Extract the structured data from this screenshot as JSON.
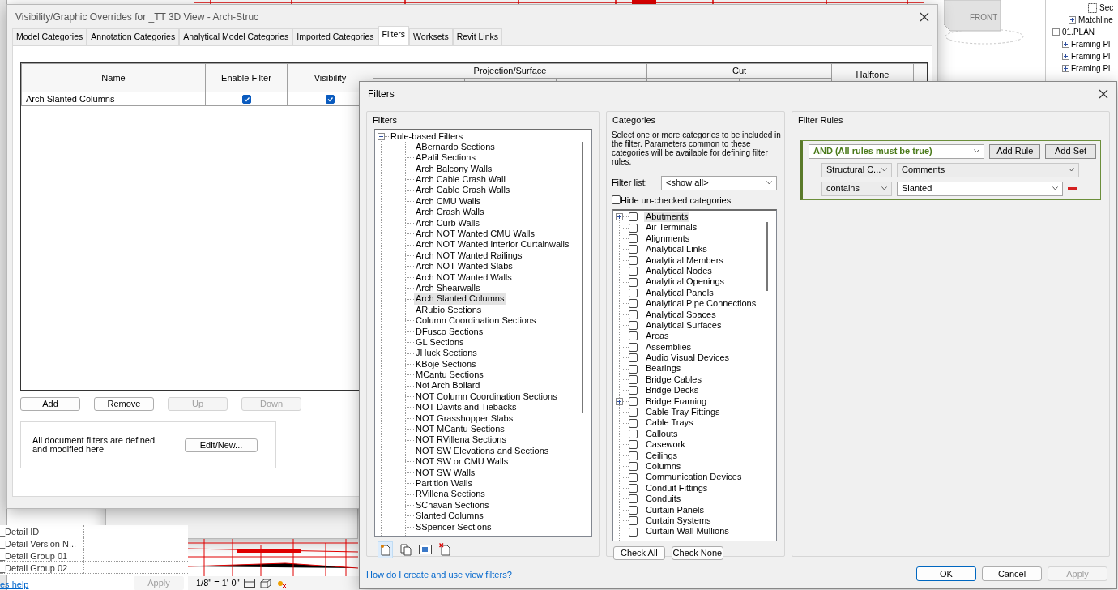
{
  "background": {
    "view_cube": "FRONT",
    "project_browser": [
      {
        "label": "Sec",
        "kind": "view"
      },
      {
        "label": "Matchline",
        "kind": "folder",
        "expanded": false
      },
      {
        "label": "01.PLAN",
        "kind": "folder",
        "expanded": true,
        "children": [
          {
            "label": "Framing Pl",
            "kind": "folder",
            "expanded": false
          },
          {
            "label": "Framing Pl",
            "kind": "folder",
            "expanded": false
          },
          {
            "label": "Framing Pl",
            "kind": "folder",
            "expanded": false
          }
        ]
      }
    ],
    "parameters": [
      "_Detail ID",
      "_Detail Version N...",
      "_Detail Group 01",
      "_Detail Group 02"
    ],
    "help_link": "es help",
    "apply_button": "Apply",
    "scale": "1/8\" = 1'-0\""
  },
  "vg_dialog": {
    "title": "Visibility/Graphic Overrides for _TT 3D View - Arch-Struc",
    "tabs": [
      {
        "label": "Model Categories",
        "selected": false
      },
      {
        "label": "Annotation Categories",
        "selected": false
      },
      {
        "label": "Analytical Model Categories",
        "selected": false
      },
      {
        "label": "Imported Categories",
        "selected": false
      },
      {
        "label": "Filters",
        "selected": true
      },
      {
        "label": "Worksets",
        "selected": false
      },
      {
        "label": "Revit Links",
        "selected": false
      }
    ],
    "table": {
      "columns": [
        "Name",
        "Enable Filter",
        "Visibility"
      ],
      "column_groups": [
        "Projection/Surface",
        "Cut"
      ],
      "last_column": "Halftone",
      "rows": [
        {
          "name": "Arch Slanted Columns",
          "enable_filter": true,
          "visibility": true
        }
      ]
    },
    "buttons": [
      {
        "label": "Add",
        "disabled": false
      },
      {
        "label": "Remove",
        "disabled": false
      },
      {
        "label": "Up",
        "disabled": true
      },
      {
        "label": "Down",
        "disabled": true
      }
    ],
    "note": "All document filters are defined and modified here",
    "edit_button": "Edit/New..."
  },
  "filters_dialog": {
    "title": "Filters",
    "filters": {
      "title": "Filters",
      "tree": {
        "label": "Rule-based Filters",
        "expanded": true,
        "children": [
          {
            "label": "ABernardo Sections",
            "selected": false
          },
          {
            "label": "APatil Sections",
            "selected": false
          },
          {
            "label": "Arch Balcony Walls",
            "selected": false
          },
          {
            "label": "Arch Cable Crash Wall",
            "selected": false
          },
          {
            "label": "Arch Cable Crash Walls",
            "selected": false
          },
          {
            "label": "Arch CMU Walls",
            "selected": false
          },
          {
            "label": "Arch Crash Walls",
            "selected": false
          },
          {
            "label": "Arch Curb Walls",
            "selected": false
          },
          {
            "label": "Arch NOT Wanted CMU Walls",
            "selected": false
          },
          {
            "label": "Arch NOT Wanted Interior Curtainwalls",
            "selected": false
          },
          {
            "label": "Arch NOT Wanted Railings",
            "selected": false
          },
          {
            "label": "Arch NOT Wanted Slabs",
            "selected": false
          },
          {
            "label": "Arch NOT Wanted Walls",
            "selected": false
          },
          {
            "label": "Arch Shearwalls",
            "selected": false
          },
          {
            "label": "Arch Slanted Columns",
            "selected": true
          },
          {
            "label": "ARubio Sections",
            "selected": false
          },
          {
            "label": "Column Coordination Sections",
            "selected": false
          },
          {
            "label": "DFusco Sections",
            "selected": false
          },
          {
            "label": "GL Sections",
            "selected": false
          },
          {
            "label": "JHuck Sections",
            "selected": false
          },
          {
            "label": "KBoje Sections",
            "selected": false
          },
          {
            "label": "MCantu Sections",
            "selected": false
          },
          {
            "label": "Not Arch Bollard",
            "selected": false
          },
          {
            "label": "NOT Column Coordination Sections",
            "selected": false
          },
          {
            "label": "NOT Davits and Tiebacks",
            "selected": false
          },
          {
            "label": "NOT Grasshopper Slabs",
            "selected": false
          },
          {
            "label": "NOT MCantu Sections",
            "selected": false
          },
          {
            "label": "NOT RVillena Sections",
            "selected": false
          },
          {
            "label": "NOT SW Elevations and Sections",
            "selected": false
          },
          {
            "label": "NOT SW or CMU Walls",
            "selected": false
          },
          {
            "label": "NOT SW Walls",
            "selected": false
          },
          {
            "label": "Partition Walls",
            "selected": false
          },
          {
            "label": "RVillena Sections",
            "selected": false
          },
          {
            "label": "SChavan Sections",
            "selected": false
          },
          {
            "label": "Slanted Columns",
            "selected": false
          },
          {
            "label": "SSpencer Sections",
            "selected": false
          }
        ]
      }
    },
    "categories": {
      "title": "Categories",
      "description": "Select one or more categories to be included in the filter.  Parameters common to these categories will be available for defining filter rules.",
      "filter_list_label": "Filter list:",
      "filter_list_value": "<show all>",
      "hide_unchecked": {
        "label": "Hide un-checked categories",
        "checked": false
      },
      "items": [
        {
          "label": "Abutments",
          "kind": "group",
          "checked": false,
          "selected": true
        },
        {
          "label": "Air Terminals",
          "kind": "leaf",
          "checked": false,
          "selected": false
        },
        {
          "label": "Alignments",
          "kind": "leaf",
          "checked": false,
          "selected": false
        },
        {
          "label": "Analytical Links",
          "kind": "leaf",
          "checked": false,
          "selected": false
        },
        {
          "label": "Analytical Members",
          "kind": "leaf",
          "checked": false,
          "selected": false
        },
        {
          "label": "Analytical Nodes",
          "kind": "leaf",
          "checked": false,
          "selected": false
        },
        {
          "label": "Analytical Openings",
          "kind": "leaf",
          "checked": false,
          "selected": false
        },
        {
          "label": "Analytical Panels",
          "kind": "leaf",
          "checked": false,
          "selected": false
        },
        {
          "label": "Analytical Pipe Connections",
          "kind": "leaf",
          "checked": false,
          "selected": false
        },
        {
          "label": "Analytical Spaces",
          "kind": "leaf",
          "checked": false,
          "selected": false
        },
        {
          "label": "Analytical Surfaces",
          "kind": "leaf",
          "checked": false,
          "selected": false
        },
        {
          "label": "Areas",
          "kind": "leaf",
          "checked": false,
          "selected": false
        },
        {
          "label": "Assemblies",
          "kind": "leaf",
          "checked": false,
          "selected": false
        },
        {
          "label": "Audio Visual Devices",
          "kind": "leaf",
          "checked": false,
          "selected": false
        },
        {
          "label": "Bearings",
          "kind": "leaf",
          "checked": false,
          "selected": false
        },
        {
          "label": "Bridge Cables",
          "kind": "leaf",
          "checked": false,
          "selected": false
        },
        {
          "label": "Bridge Decks",
          "kind": "leaf",
          "checked": false,
          "selected": false
        },
        {
          "label": "Bridge Framing",
          "kind": "group",
          "checked": false,
          "selected": false
        },
        {
          "label": "Cable Tray Fittings",
          "kind": "leaf",
          "checked": false,
          "selected": false
        },
        {
          "label": "Cable Trays",
          "kind": "leaf",
          "checked": false,
          "selected": false
        },
        {
          "label": "Callouts",
          "kind": "leaf",
          "checked": false,
          "selected": false
        },
        {
          "label": "Casework",
          "kind": "leaf",
          "checked": false,
          "selected": false
        },
        {
          "label": "Ceilings",
          "kind": "leaf",
          "checked": false,
          "selected": false
        },
        {
          "label": "Columns",
          "kind": "leaf",
          "checked": false,
          "selected": false
        },
        {
          "label": "Communication Devices",
          "kind": "leaf",
          "checked": false,
          "selected": false
        },
        {
          "label": "Conduit Fittings",
          "kind": "leaf",
          "checked": false,
          "selected": false
        },
        {
          "label": "Conduits",
          "kind": "leaf",
          "checked": false,
          "selected": false
        },
        {
          "label": "Curtain Panels",
          "kind": "leaf",
          "checked": false,
          "selected": false
        },
        {
          "label": "Curtain Systems",
          "kind": "leaf",
          "checked": false,
          "selected": false
        },
        {
          "label": "Curtain Wall Mullions",
          "kind": "leaf",
          "checked": false,
          "selected": false
        }
      ],
      "buttons": [
        "Check All",
        "Check None"
      ]
    },
    "rules": {
      "title": "Filter Rules",
      "operator": "AND (All rules must be true)",
      "buttons": [
        "Add Rule",
        "Add Set"
      ],
      "rule": {
        "category": "Structural C...",
        "parameter": "Comments",
        "condition": "contains",
        "value": "Slanted"
      }
    },
    "help_link": "How do I create and use view filters?",
    "buttons": [
      {
        "label": "OK",
        "kind": "default",
        "disabled": false
      },
      {
        "label": "Cancel",
        "kind": "normal",
        "disabled": false
      },
      {
        "label": "Apply",
        "kind": "normal",
        "disabled": true
      }
    ]
  }
}
